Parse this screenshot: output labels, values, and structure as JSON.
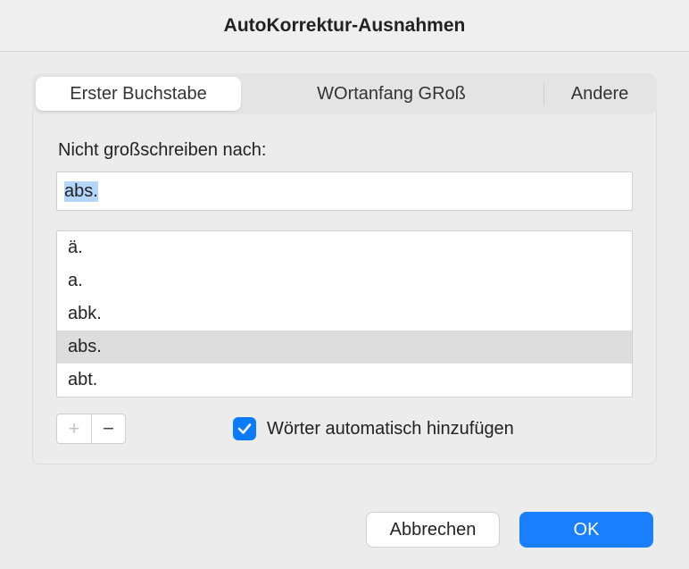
{
  "title": "AutoKorrektur-Ausnahmen",
  "tabs": [
    {
      "label": "Erster Buchstabe",
      "active": true
    },
    {
      "label": "WOrtanfang GRoß",
      "active": false
    },
    {
      "label": "Andere",
      "active": false
    }
  ],
  "panel": {
    "label": "Nicht großschreiben nach:",
    "input_value": "abs.",
    "list": [
      {
        "text": "ä.",
        "selected": false
      },
      {
        "text": "a.",
        "selected": false
      },
      {
        "text": "abk.",
        "selected": false
      },
      {
        "text": "abs.",
        "selected": true
      },
      {
        "text": "abt.",
        "selected": false
      }
    ],
    "add_enabled": false,
    "remove_enabled": true,
    "checkbox": {
      "checked": true,
      "label": "Wörter automatisch hinzufügen"
    }
  },
  "buttons": {
    "cancel": "Abbrechen",
    "ok": "OK"
  }
}
